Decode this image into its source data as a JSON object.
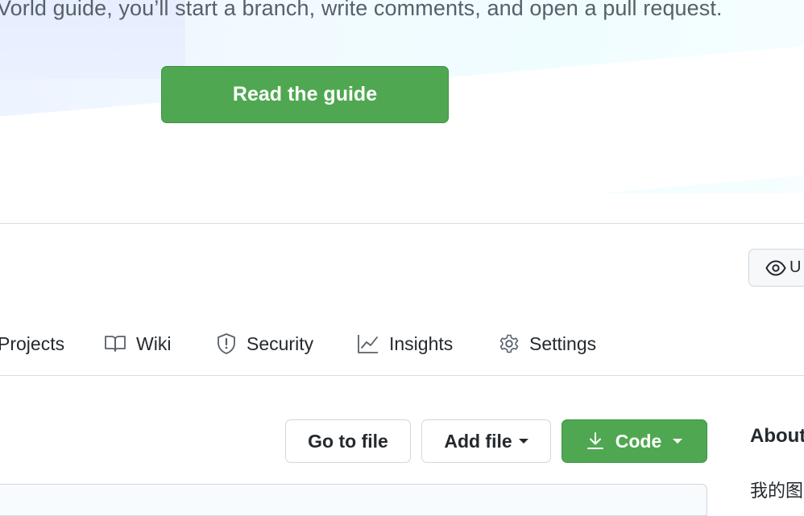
{
  "hero": {
    "text": "Vorld guide, you’ll start a branch, write comments, and open a pull request.",
    "button_label": "Read the guide"
  },
  "repo_header": {
    "watch_label": "U"
  },
  "tabs": [
    {
      "label": "Projects",
      "icon": "table-icon"
    },
    {
      "label": "Wiki",
      "icon": "book-icon"
    },
    {
      "label": "Security",
      "icon": "shield-icon"
    },
    {
      "label": "Insights",
      "icon": "graph-icon"
    },
    {
      "label": "Settings",
      "icon": "gear-icon"
    }
  ],
  "file_actions": {
    "go_to_file": "Go to file",
    "add_file": "Add file",
    "code": "Code"
  },
  "about": {
    "title": "About",
    "description": "我的图"
  },
  "colors": {
    "primary_green": "#4fa851",
    "text": "#24292f",
    "muted": "#57606a",
    "border": "#d0d7de"
  }
}
